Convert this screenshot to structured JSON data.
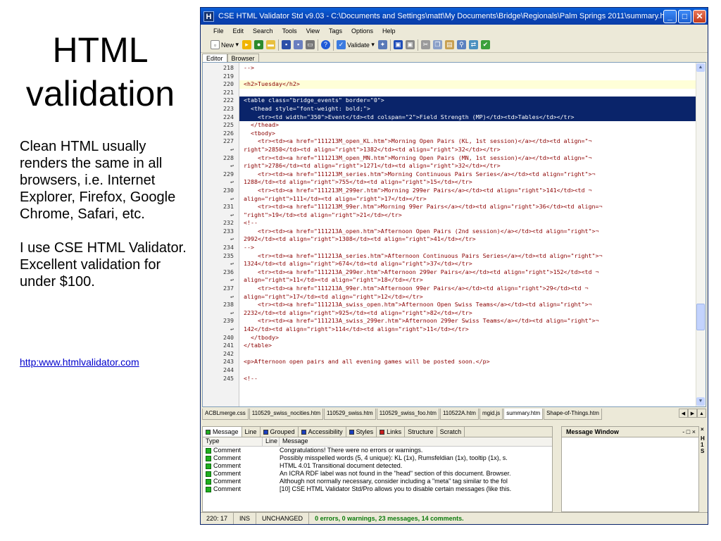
{
  "slide": {
    "title_line1": "HTML",
    "title_line2": "validation",
    "para1": "Clean HTML usually renders the same in all browsers, i.e. Internet Explorer, Firefox, Google Chrome, Safari, etc.",
    "para2": "I use CSE HTML Validator. Excellent validation for under $100.",
    "link": "http:www.htmlvalidator.com"
  },
  "window": {
    "app_icon": "H",
    "title": "CSE HTML Validator Std v9.03 - C:\\Documents and Settings\\matt\\My Documents\\Bridge\\Regionals\\Palm Springs 2011\\summary.htm",
    "controls": [
      "_",
      "□",
      "✕"
    ]
  },
  "menu": [
    "File",
    "Edit",
    "Search",
    "Tools",
    "View",
    "Tags",
    "Options",
    "Help"
  ],
  "toolbar": {
    "new_label": "New",
    "validate_label": "Validate",
    "icons": [
      "new-icon",
      "open-icon",
      "globe-icon",
      "folder-icon",
      "save-icon",
      "save-all-icon",
      "print-icon",
      "help-icon",
      "validate-icon",
      "wizard-icon",
      "blue-box-icon",
      "gray-box-icon",
      "cut-icon",
      "copy-icon",
      "paste-icon",
      "find-icon",
      "replace-icon",
      "spellcheck-icon"
    ]
  },
  "editor_tabs": [
    "Editor",
    "Browser"
  ],
  "code_lines": [
    {
      "n": "218",
      "t": "-->",
      "s": ""
    },
    {
      "n": "219",
      "t": "",
      "s": ""
    },
    {
      "n": "220",
      "t": "<h2>Tuesday</h2>",
      "s": "hl"
    },
    {
      "n": "221",
      "t": "",
      "s": ""
    },
    {
      "n": "222",
      "t": "<table class=\"bridge_events\" border=\"0\">",
      "s": "sel"
    },
    {
      "n": "223",
      "t": "  <thead style=\"font-weight: bold;\">",
      "s": "sel"
    },
    {
      "n": "224",
      "t": "    <tr><td width=\"350\">Event</td><td colspan=\"2\">Field Strength (MP)</td><td>Tables</td></tr>",
      "s": "sel"
    },
    {
      "n": "225",
      "t": "  </thead>",
      "s": ""
    },
    {
      "n": "226",
      "t": "  <tbody>",
      "s": ""
    },
    {
      "n": "227",
      "t": "    <tr><td><a href=\"111213M_open_KL.htm\">Morning Open Pairs (KL, 1st session)</a></td><td align=\"¬",
      "s": ""
    },
    {
      "n": "↩",
      "t": "right\">2850</td><td align=\"right\">1382</td><td align=\"right\">32</td></tr>",
      "s": ""
    },
    {
      "n": "228",
      "t": "    <tr><td><a href=\"111213M_open_MN.htm\">Morning Open Pairs (MN, 1st session)</a></td><td align=\"¬",
      "s": ""
    },
    {
      "n": "↩",
      "t": "right\">2786</td><td align=\"right\">1271</td><td align=\"right\">32</td></tr>",
      "s": ""
    },
    {
      "n": "229",
      "t": "    <tr><td><a href=\"111213M_series.htm\">Morning Continuous Pairs Series</a></td><td align=\"right\">¬",
      "s": ""
    },
    {
      "n": "↩",
      "t": "1288</td><td align=\"right\">755</td><td align=\"right\">15</td></tr>",
      "s": ""
    },
    {
      "n": "230",
      "t": "    <tr><td><a href=\"111213M_299er.htm\">Morning 299er Pairs</a></td><td align=\"right\">141</td><td ¬",
      "s": ""
    },
    {
      "n": "↩",
      "t": "align=\"right\">111</td><td align=\"right\">17</td></tr>",
      "s": ""
    },
    {
      "n": "231",
      "t": "    <tr><td><a href=\"111213M_99er.htm\">Morning 99er Pairs</a></td><td align=\"right\">36</td><td align=¬",
      "s": ""
    },
    {
      "n": "↩",
      "t": "\"right\">19</td><td align=\"right\">21</td></tr>",
      "s": ""
    },
    {
      "n": "232",
      "t": "<!--",
      "s": ""
    },
    {
      "n": "233",
      "t": "    <tr><td><a href=\"111213A_open.htm\">Afternoon Open Pairs (2nd session)</a></td><td align=\"right\">¬",
      "s": ""
    },
    {
      "n": "↩",
      "t": "2992</td><td align=\"right\">1308</td><td align=\"right\">41</td></tr>",
      "s": ""
    },
    {
      "n": "234",
      "t": "-->",
      "s": ""
    },
    {
      "n": "235",
      "t": "    <tr><td><a href=\"111213A_series.htm\">Afternoon Continuous Pairs Series</a></td><td align=\"right\">¬",
      "s": ""
    },
    {
      "n": "↩",
      "t": "1324</td><td align=\"right\">674</td><td align=\"right\">37</td></tr>",
      "s": ""
    },
    {
      "n": "236",
      "t": "    <tr><td><a href=\"111213A_299er.htm\">Afternoon 299er Pairs</a></td><td align=\"right\">152</td><td ¬",
      "s": ""
    },
    {
      "n": "↩",
      "t": "align=\"right\">11</td><td align=\"right\">18</td></tr>",
      "s": ""
    },
    {
      "n": "237",
      "t": "    <tr><td><a href=\"111213A_99er.htm\">Afternoon 99er Pairs</a></td><td align=\"right\">29</td><td ¬",
      "s": ""
    },
    {
      "n": "↩",
      "t": "align=\"right\">17</td><td align=\"right\">12</td></tr>",
      "s": ""
    },
    {
      "n": "238",
      "t": "    <tr><td><a href=\"111213A_swiss_open.htm\">Afternoon Open Swiss Teams</a></td><td align=\"right\">¬",
      "s": ""
    },
    {
      "n": "↩",
      "t": "2232</td><td align=\"right\">925</td><td align=\"right\">82</td></tr>",
      "s": ""
    },
    {
      "n": "239",
      "t": "    <tr><td><a href=\"111213A_swiss_299er.htm\">Afternoon 299er Swiss Teams</a></td><td align=\"right\">¬",
      "s": ""
    },
    {
      "n": "↩",
      "t": "142</td><td align=\"right\">114</td><td align=\"right\">11</td></tr>",
      "s": ""
    },
    {
      "n": "240",
      "t": "  </tbody>",
      "s": ""
    },
    {
      "n": "241",
      "t": "</table>",
      "s": ""
    },
    {
      "n": "242",
      "t": "",
      "s": ""
    },
    {
      "n": "243",
      "t": "<p>Afternoon open pairs and all evening games will be posted soon.</p>",
      "s": ""
    },
    {
      "n": "244",
      "t": "",
      "s": ""
    },
    {
      "n": "245",
      "t": "<!--",
      "s": ""
    }
  ],
  "file_tabs": [
    {
      "label": "ACBLmerge.css",
      "active": false
    },
    {
      "label": "110529_swiss_nocities.htm",
      "active": false
    },
    {
      "label": "110529_swiss.htm",
      "active": false
    },
    {
      "label": "110529_swiss_foo.htm",
      "active": false
    },
    {
      "label": "110522A.htm",
      "active": false
    },
    {
      "label": "mgid.js",
      "active": false
    },
    {
      "label": "summary.htm",
      "active": true
    },
    {
      "label": "Shape-of-Things.htm",
      "active": false
    }
  ],
  "message_tabs": [
    {
      "label": "Message",
      "color": "#1fae1f"
    },
    {
      "label": "Line",
      "color": ""
    },
    {
      "label": "Grouped",
      "color": "#1a3fbf"
    },
    {
      "label": "Accessibility",
      "color": "#1a3fbf"
    },
    {
      "label": "Styles",
      "color": "#1a3fbf"
    },
    {
      "label": "Links",
      "color": "#c81e1e"
    },
    {
      "label": "Structure",
      "color": ""
    },
    {
      "label": "Scratch",
      "color": ""
    }
  ],
  "message_columns": {
    "type": "Type",
    "line": "Line",
    "message": "Message"
  },
  "messages": [
    {
      "type": "Comment",
      "text": "Congratulations! There were no errors or warnings."
    },
    {
      "type": "Comment",
      "text": "Possibly misspelled words (5, 4 unique): KL (1x), Rumsfeldian (1x), tooltip (1x), s."
    },
    {
      "type": "Comment",
      "text": "HTML 4.01 Transitional document detected."
    },
    {
      "type": "Comment",
      "text": "An ICRA RDF label was not found in the \"head\" section of this document. Browser."
    },
    {
      "type": "Comment",
      "text": "Although not normally necessary, consider including a \"meta\" tag similar to the fol"
    },
    {
      "type": "Comment",
      "text": "[10] CSE HTML Validator Std/Pro allows you to disable certain messages (like this."
    }
  ],
  "message_window": {
    "title": "Message Window",
    "controls": "- □ ×"
  },
  "right_strip": [
    "×",
    "H",
    "1",
    "S"
  ],
  "status": {
    "position": "220: 17",
    "mode": "INS",
    "state": "UNCHANGED",
    "result": "0 errors, 0 warnings, 23 messages, 14 comments."
  }
}
